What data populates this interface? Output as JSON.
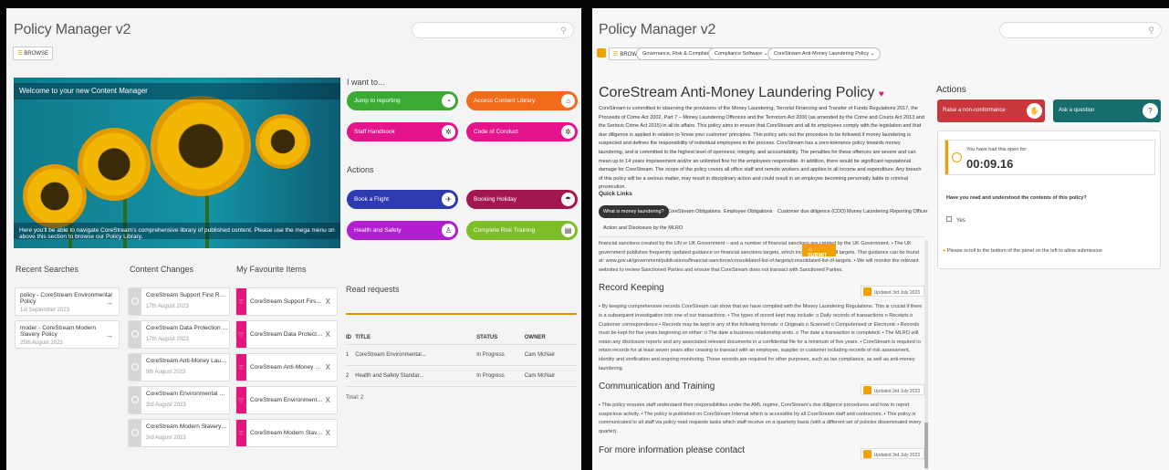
{
  "left": {
    "app_title": "Policy Manager v2",
    "search_icon": "search-icon",
    "browse": "BROWSE",
    "hero": {
      "welcome": "Welcome to your new Content Manager",
      "caption": "Here you'll be able to navigate CoreStream's comprehensive library of published content. Please use the mega menu on above this section to browse our Policy Library."
    },
    "i_want_to": "I want to...",
    "tiles": [
      {
        "label": "Jump to reporting",
        "color": "#3aaa35",
        "icon": "chart-icon"
      },
      {
        "label": "Access Content Library",
        "color": "#f26b1d",
        "icon": "library-icon"
      },
      {
        "label": "Staff Handbook",
        "color": "#e4148c",
        "icon": "handbook-icon"
      },
      {
        "label": "Code of Conduct",
        "color": "#e4148c",
        "icon": "conduct-icon"
      }
    ],
    "actions_title": "Actions",
    "action_tiles": [
      {
        "label": "Book a Flight",
        "color": "#2e3ab0",
        "icon": "flight-icon"
      },
      {
        "label": "Booking Holiday",
        "color": "#a3174f",
        "icon": "holiday-icon"
      },
      {
        "label": "Health and Safety",
        "color": "#b21ed0",
        "icon": "safety-icon"
      },
      {
        "label": "Complete Risk Training",
        "color": "#7cbd28",
        "icon": "training-icon"
      }
    ],
    "recent_searches": {
      "title": "Recent Searches",
      "items": [
        {
          "title": "policy - CoreStream Environmental Policy",
          "date": "1st September 2023"
        },
        {
          "title": "moder - CoreStream Modern Slavery Policy",
          "date": "25th August 2023"
        }
      ]
    },
    "content_changes": {
      "title": "Content Changes",
      "items": [
        {
          "title": "CoreStream Support First Responders G...",
          "date": "17th August 2023"
        },
        {
          "title": "CoreStream Data Protection Policy",
          "date": "17th August 2023"
        },
        {
          "title": "CoreStream Anti-Money Laundering Policy",
          "date": "9th August 2023"
        },
        {
          "title": "CoreStream Environmental Policy",
          "date": "3rd August 2023"
        },
        {
          "title": "CoreStream Modern Slavery Policy",
          "date": "3rd August 2023"
        }
      ]
    },
    "favourites": {
      "title": "My Favourite Items",
      "items": [
        "CoreStream Support First Responde...",
        "CoreStream Data Protection Policy",
        "CoreStream Anti-Money Laundering ...",
        "CoreStream Environmental Policy",
        "CoreStream Modern Slavery Policy"
      ],
      "remove": "X"
    },
    "read_requests": {
      "title": "Read requests",
      "columns": [
        "ID",
        "TITLE",
        "STATUS",
        "OWNER"
      ],
      "rows": [
        [
          "1",
          "CoreStream Environmental...",
          "In Progress",
          "Cam McNair"
        ],
        [
          "2",
          "Health and Safety Standar...",
          "In Progress",
          "Cam McNair"
        ]
      ],
      "total": "Total: 2"
    }
  },
  "right": {
    "app_title": "Policy Manager v2",
    "browse": "BROWSE",
    "breadcrumbs": [
      "Governance, Risk & Compliance ⌄",
      "Compliance Software ⌄",
      "CoreStream Anti-Money Laundering Policy ⌄"
    ],
    "policy_title": "CoreStream Anti-Money Laundering Policy",
    "policy_text": "CoreStream is committed to observing the provisions of the Money Laundering, Terrorist Financing and Transfer of Funds Regulations 2017, the Proceeds of Crime Act 2002, Part 7 – Money Laundering Offences and the Terrorism Act 2000 (as amended by the Crime and Courts Act 2013 and the Serious Crime Act 2015) in all its affairs. This policy aims to ensure that CoreStream and all its employees comply with the legislation and that due diligence is applied in relation to 'know your customer' principles. This policy sets out the procedure to be followed if money laundering is suspected and defines the responsibility of individual employees in the process. CoreStream has a zero-tolerance policy towards money laundering, and is committed to the highest level of openness, integrity, and accountability. The penalties for these offences are severe and can mean up to 14 years imprisonment and/or an unlimited fine for the employees responsible. In addition, there would be significant reputational damage for CoreStream. The scope of the policy covers all office staff and remote workers and applies to all income and expenditure. Any breach of this policy will be a serious matter, may result in disciplinary action and could result in an employee becoming personally liable to criminal prosecution.",
    "quick_links_title": "Quick Links",
    "quick_links": [
      "What is money laundering?",
      "CoreStream Obligations",
      "Employee Obligations",
      "Customer due diligence (CDD)",
      "Money Laundering Reporting Officer",
      "Action and Disclosure by the MLRO"
    ],
    "content_top": "financial sanctions created by the UN or UK Government – and a number of financial sanctions are created by the UK Government. • The UK government publishes frequently updated guidance on financial sanctions targets, which includes a list of all targets. This guidance can be found at: www.gov.uk/government/publications/financial-sanctions/consolidated-list-of-targets/consolidated-list-of-targets. • We will monitor the relevant websites to review Sanctioned Parties and ensure that CoreStream does not transact with Sanctioned Parties.",
    "sections": [
      {
        "title": "Record Keeping",
        "updated": "Updated 3rd July 2023",
        "text": "• By keeping comprehensive records CoreStream can show that we have complied with the Money Laundering Regulations. This is crucial if there is a subsequent investigation into one of our transactions. • The types of record kept may include: o Daily records of transactions o Receipts o Customer correspondence • Records may be kept in any of the following formats: o Originals o Scanned o Computerised or Electronic • Records must be kept for five years beginning on either: o The date a business relationship ends. o The date a transaction is completed. • The MLRO will retain any disclosure reports and any associated relevant documents in a confidential file for a minimum of five years. • CoreStream is required to retain records for at least seven years after ceasing to transact with an employee, supplier or customer including records of risk assessment, identity and verification and ongoing monitoring. These records are required for other purposes, such as tax compliance, as well as anti-money laundering."
      },
      {
        "title": "Communication and Training",
        "updated": "Updated 3rd July 2023",
        "text": "• This policy ensures staff understand their responsibilities under the AML regime, CoreStream's due diligence procedures and how to report suspicious activity. • The policy is published on CoreStream Internal which is accessible by all CoreStream staff and contractors. • This policy is communicated to all staff via policy read requests tasks which staff receive on a quarterly basis (with a different set of policies disseminated every quarter)."
      },
      {
        "title": "For more information please contact",
        "updated": "Updated 3rd July 2023",
        "text": ""
      }
    ],
    "actions_title": "Actions",
    "action_buttons": [
      {
        "label": "Raise a non-conformance",
        "color": "#c8373c",
        "icon": "hand-icon"
      },
      {
        "label": "Ask a question",
        "color": "#166d6b",
        "icon": "question-icon"
      }
    ],
    "timer_label": "You have had this open for:",
    "timer_value": "00:09.16",
    "question": "Have you read and understood the contents of this policy?",
    "yes_label": "Yes",
    "scroll_notice": "Please scroll to the bottom of the panel on the left to allow submission",
    "submit": "SUBMIT"
  }
}
